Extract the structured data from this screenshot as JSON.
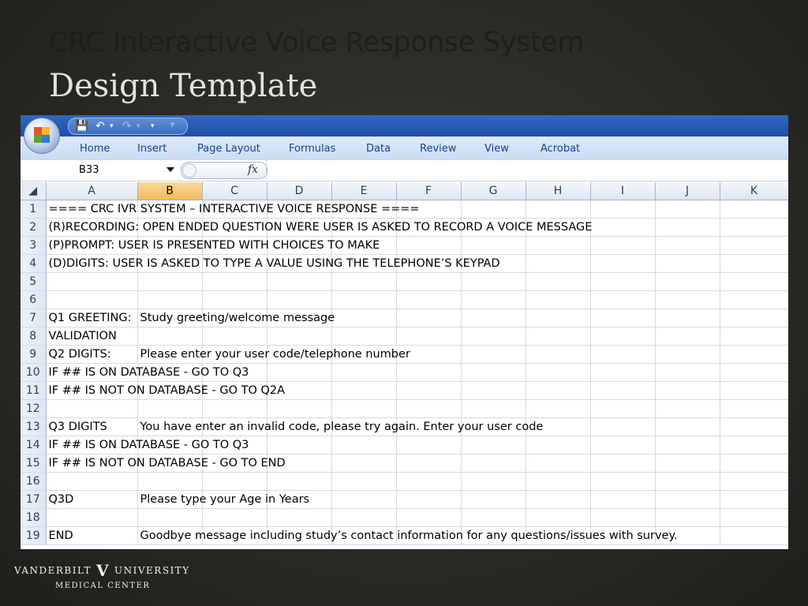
{
  "slide": {
    "title_line1": "CRC Interactive Voice Response System",
    "title_line2": "Design Template"
  },
  "ribbon": {
    "tabs": [
      "Home",
      "Insert",
      "Page Layout",
      "Formulas",
      "Data",
      "Review",
      "View",
      "Acrobat"
    ]
  },
  "formula_bar": {
    "name_box": "B33",
    "fx_label": "fx",
    "value": ""
  },
  "columns": [
    "A",
    "B",
    "C",
    "D",
    "E",
    "F",
    "G",
    "H",
    "I",
    "J",
    "K"
  ],
  "selected_column": "B",
  "rows": [
    {
      "n": "1",
      "a": "==== CRC IVR SYSTEM – INTERACTIVE VOICE RESPONSE ====",
      "b": ""
    },
    {
      "n": "2",
      "a": "(R)RECORDING: OPEN ENDED QUESTION WERE USER IS ASKED TO RECORD A VOICE MESSAGE",
      "b": ""
    },
    {
      "n": "3",
      "a": "(P)PROMPT: USER IS PRESENTED WITH CHOICES TO MAKE",
      "b": ""
    },
    {
      "n": "4",
      "a": "(D)DIGITS: USER IS ASKED TO TYPE A VALUE USING THE TELEPHONE’S KEYPAD",
      "b": ""
    },
    {
      "n": "5",
      "a": "",
      "b": ""
    },
    {
      "n": "6",
      "a": "",
      "b": ""
    },
    {
      "n": "7",
      "a": "Q1 GREETING:",
      "b": "Study greeting/welcome message"
    },
    {
      "n": "8",
      "a": "VALIDATION",
      "b": ""
    },
    {
      "n": "9",
      "a": "Q2 DIGITS:",
      "b": "Please enter your user code/telephone number"
    },
    {
      "n": "10",
      "a": " IF ## IS ON DATABASE - GO TO Q3",
      "b": ""
    },
    {
      "n": "11",
      "a": "IF ## IS NOT ON DATABASE - GO TO Q2A",
      "b": ""
    },
    {
      "n": "12",
      "a": "",
      "b": ""
    },
    {
      "n": "13",
      "a": "Q3 DIGITS",
      "b": "You have enter an invalid code, please try again. Enter your user code"
    },
    {
      "n": "14",
      "a": " IF ## IS ON DATABASE - GO TO Q3",
      "b": ""
    },
    {
      "n": "15",
      "a": "IF ## IS NOT ON DATABASE - GO TO END",
      "b": ""
    },
    {
      "n": "16",
      "a": "",
      "b": ""
    },
    {
      "n": "17",
      "a": "Q3D",
      "b": "Please type your Age in Years"
    },
    {
      "n": "18",
      "a": "",
      "b": ""
    },
    {
      "n": "19",
      "a": "END",
      "b": "Goodbye message including study’s contact information for any questions/issues with survey."
    }
  ],
  "footer_logo": {
    "left": "VANDERBILT",
    "mark": "V",
    "right": "UNIVERSITY",
    "sub": "MEDICAL CENTER"
  }
}
